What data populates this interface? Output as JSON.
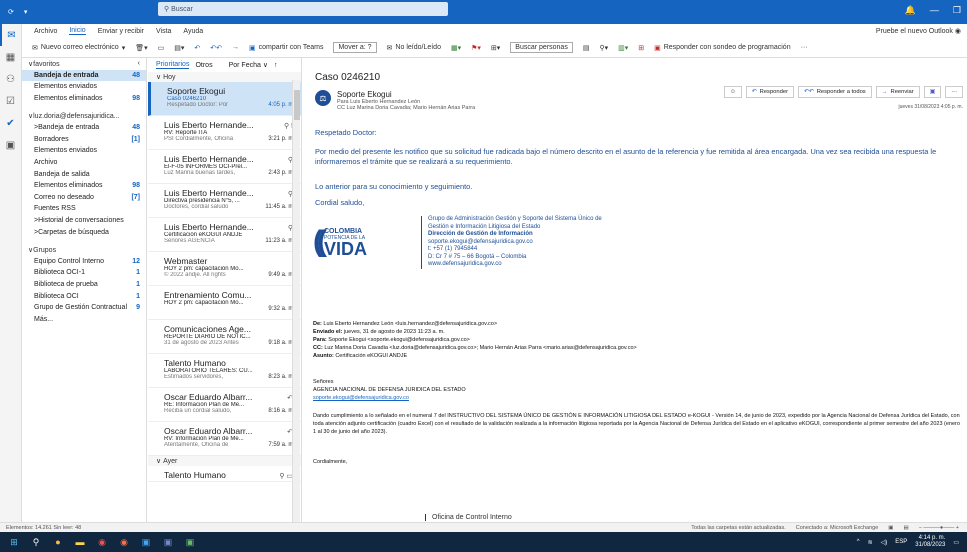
{
  "titlebar": {
    "search_placeholder": "Buscar"
  },
  "menu": {
    "items": [
      "Archivo",
      "Inicio",
      "Enviar y recibir",
      "Vista",
      "Ayuda"
    ],
    "try_new": "Pruebe el nuevo Outlook"
  },
  "ribbon": {
    "new_email": "Nuevo correo electrónico",
    "teams": "compartir con Teams",
    "move": "Mover a: ?",
    "unread": "No leído/Leído",
    "search_people": "Buscar personas",
    "schedule": "Responder con sondeo de programación"
  },
  "folders": {
    "favorites": "favoritos",
    "fav_items": [
      {
        "label": "Bandeja de entrada",
        "count": "48"
      },
      {
        "label": "Elementos enviados",
        "count": ""
      },
      {
        "label": "Elementos eliminados",
        "count": "98"
      }
    ],
    "account": "luz.doria@defensajuridica...",
    "acct_items": [
      {
        "label": "Bandeja de entrada",
        "count": "48"
      },
      {
        "label": "Borradores",
        "count": "[1]"
      },
      {
        "label": "Elementos enviados",
        "count": ""
      },
      {
        "label": "Archivo",
        "count": ""
      },
      {
        "label": "Bandeja de salida",
        "count": ""
      },
      {
        "label": "Elementos eliminados",
        "count": "98"
      },
      {
        "label": "Correo no deseado",
        "count": "[7]"
      },
      {
        "label": "Fuentes RSS",
        "count": ""
      },
      {
        "label": "Historial de conversaciones",
        "count": ""
      },
      {
        "label": "Carpetas de búsqueda",
        "count": ""
      }
    ],
    "groups_title": "Grupos",
    "groups": [
      {
        "label": "Equipo Control Interno",
        "count": "12"
      },
      {
        "label": "Biblioteca OCI-1",
        "count": "1"
      },
      {
        "label": "Biblioteca de prueba",
        "count": "1"
      },
      {
        "label": "Biblioteca OCI",
        "count": "1"
      },
      {
        "label": "Grupo de Gestión Contractual",
        "count": "9"
      },
      {
        "label": "Más...",
        "count": ""
      }
    ]
  },
  "list": {
    "tab_focused": "Prioritarios",
    "tab_other": "Otros",
    "sort": "Por Fecha ∨",
    "group_today": "Hoy",
    "group_yesterday": "Ayer",
    "mails": [
      {
        "sender": "Soporte Ekogui",
        "subject": "Caso 0246210",
        "preview": "Respetado Doctor: Por",
        "time": "4:05 p. m.",
        "icon": ""
      },
      {
        "sender": "Luis Eberto Hernande...",
        "subject": "RV: Reporte ITA",
        "preview": "PSI Cordialmente, Oficina",
        "time": "3:21 p. m.",
        "icon": "⚲ !"
      },
      {
        "sender": "Luis Eberto Hernande...",
        "subject": "El-F-05 INFORMES OCI-Prel...",
        "preview": "Luz Marina buenas tardes,",
        "time": "2:43 p. m.",
        "icon": "⚲"
      },
      {
        "sender": "Luis Eberto Hernande...",
        "subject": "Directiva presidencia N°5, ...",
        "preview": "Doctores, cordial saludo",
        "time": "11:45 a. m.",
        "icon": "⚲"
      },
      {
        "sender": "Luis Eberto Hernande...",
        "subject": "Certificación eKOGUI ANDJE",
        "preview": "Señores AGENCIA",
        "time": "11:23 a. m.",
        "icon": "⚲"
      },
      {
        "sender": "Webmaster",
        "subject": "HOY 2 pm: capacitación Mo...",
        "preview": "© 2022 andje. All rights",
        "time": "9:49 a. m.",
        "icon": ""
      },
      {
        "sender": "Entrenamiento Comu...",
        "subject": "HOY 2 pm: capacitación Mo...",
        "preview": "",
        "time": "9:32 a. m.",
        "icon": ""
      },
      {
        "sender": "Comunicaciones Age...",
        "subject": "REPORTE DIARIO DE NOTIC...",
        "preview": "31 de agosto de 2023 Antes",
        "time": "9:18 a. m.",
        "icon": ""
      },
      {
        "sender": "Talento Humano",
        "subject": "LABORATORIO TELARES: CU...",
        "preview": "Estimados servidores,",
        "time": "8:23 a. m.",
        "icon": ""
      },
      {
        "sender": "Oscar Eduardo Albarr...",
        "subject": "RE: Información Plan de Me...",
        "preview": "Reciba un cordial saludo,",
        "time": "8:16 a. m.",
        "icon": "↶"
      },
      {
        "sender": "Oscar Eduardo Albarr...",
        "subject": "RV: Información Plan de Me...",
        "preview": "Atentamente, Oficina de",
        "time": "7:59 a. m.",
        "icon": "↶"
      }
    ],
    "yesterday_first": "Talento Humano"
  },
  "reading": {
    "subject": "Caso 0246210",
    "sender": "Soporte Ekogui",
    "to_line": "Para   Luis Eberto Hernandez León",
    "cc_line": "CC   Luz Marina Doria Cavadia; Mario Hernán Arias Parra",
    "actions": [
      "Responder",
      "Responder a todos",
      "Reenviar"
    ],
    "timestamp": "jueves 31/08/2023 4:05 p. m.",
    "greeting": "Respetado Doctor:",
    "para1": "Por medio del presente les notifico que su solicitud fue radicada bajo el número descrito en el asunto de la referencia y fue remitida al área encargada. Una vez sea recibida una respuesta le informaremos el trámite que se realizará a su requerimiento.",
    "para2": "Lo anterior para su conocimiento y seguimiento.",
    "closing": "Cordial saludo,",
    "logo_line1": "COLOMBIA",
    "logo_line2": "POTENCIA DE LA",
    "logo_line3": "VIDA",
    "sig_group": "Grupo de Administración Gestión y Soporte del Sistema Único de Gestión e Información Litigiosa del Estado",
    "sig_dir": "Dirección de Gestión de Información",
    "sig_email": "soporte.ekogui@defensajuridica.gov.co",
    "sig_phone": "t: +57 (1) 7945844",
    "sig_addr": "D: Cr 7 # 75 – 66 Bogotá – Colombia",
    "sig_web": "www.defensajuridica.gov.co",
    "fwd_from": "Luis Eberto Hernandez León <luis.hernandez@defensajuridica.gov.co>",
    "fwd_sent": "jueves, 31 de agosto de 2023 11:23 a. m.",
    "fwd_to": "Soporte Ekogui <soporte.ekogui@defensajuridica.gov.co>",
    "fwd_cc": "Luz Marina Doria Cavadia <luz.doria@defensajuridica.gov.co>; Mario Hernán Arias Parra <mario.arias@defensajuridica.gov.co>",
    "fwd_subject": "Certificación eKOGUI ANDJE",
    "lbl_from": "De:",
    "lbl_sent": "Enviado el:",
    "lbl_to": "Para:",
    "lbl_cc": "CC:",
    "lbl_subject": "Asunto:",
    "senores": "Señores",
    "agencia": "AGENCIA NACIONAL DE DEFENSA JURIDICA DEL ESTADO",
    "agencia_mail": "soporte.ekogui@defensajuridica.gov.co",
    "fwd_body": "Dando cumplimiento a lo señalado en el numeral 7 del INSTRUCTIVO DEL SISTEMA ÚNICO DE GESTIÓN E INFORMACIÓN LITIGIOSA DEL ESTADO e-KOGUI - Versión 14, de junio de 2023, expedido por la Agencia Nacional de Defensa Jurídica del Estado, con toda atención adjunto certificación (cuadro Excel) con el resultado de la validación realizada a la información litigiosa reportada por la Agencia Nacional de Defensa Jurídica del Estado en el aplicativo eKOGUI, correspondiente al primer semestre del año 2023 (enero 1 al 30 de junio del año 2023).",
    "cordialmente": "Cordialmente,",
    "oficina": "Oficina de Control Interno"
  },
  "status": {
    "left": "Elementos: 14.261   Sin leer: 48",
    "right1": "Todas las carpetas están actualizadas.",
    "right2": "Conectado a: Microsoft Exchange"
  },
  "taskbar": {
    "time": "4:14 p. m.",
    "date": "31/08/2023",
    "lang": "ESP"
  }
}
